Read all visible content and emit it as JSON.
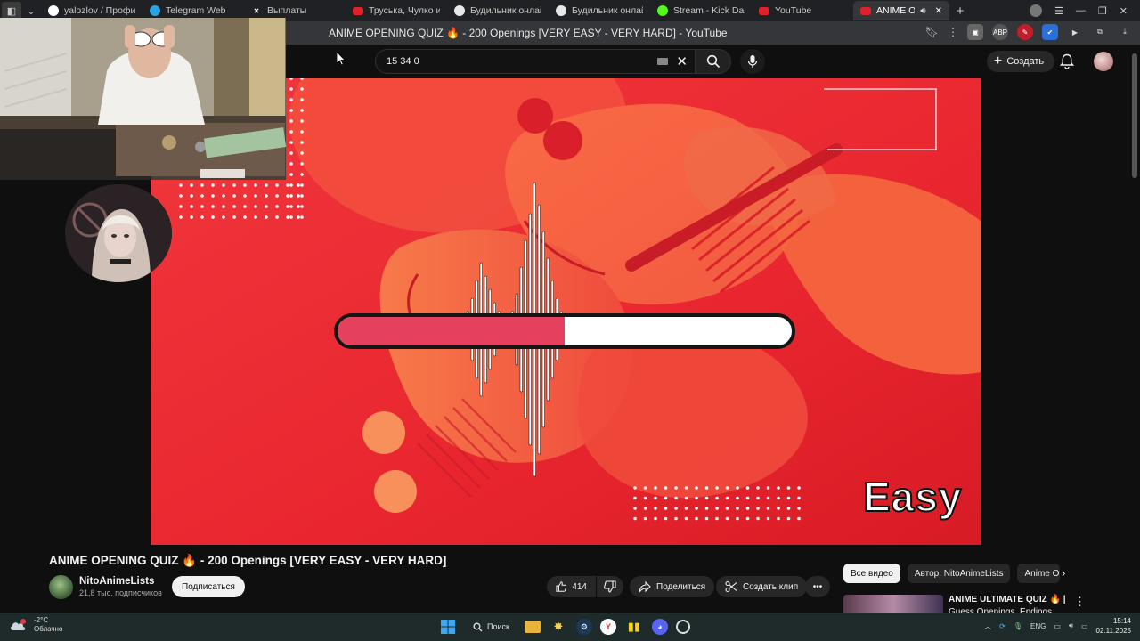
{
  "browser": {
    "tabs": [
      {
        "label": "yalozlov / Профиль",
        "icon": "profile-icon",
        "color": "#ffffff"
      },
      {
        "label": "Telegram Web",
        "icon": "telegram-icon",
        "color": "#2aa3e3"
      },
      {
        "label": "Выплаты",
        "icon": "x-icon",
        "color": "#ffffff"
      },
      {
        "label": "Труська, Чулко и пр",
        "icon": "youtube-icon",
        "color": "#e1202b"
      },
      {
        "label": "Будильник онлайн",
        "icon": "check-icon",
        "color": "#e8e8e8"
      },
      {
        "label": "Будильник онлайн",
        "icon": "check-icon",
        "color": "#e8e8e8"
      },
      {
        "label": "Stream - Kick Dashbo",
        "icon": "kick-icon",
        "color": "#53fc18"
      },
      {
        "label": "YouTube",
        "icon": "youtube-icon",
        "color": "#e1202b"
      },
      {
        "label": "ANIME OPENIN",
        "icon": "youtube-icon",
        "color": "#e1202b",
        "active": true
      }
    ],
    "window_title": "ANIME OPENING QUIZ 🔥 - 200 Openings [VERY EASY - VERY HARD] - YouTube"
  },
  "youtube": {
    "search_value": "15 34 0",
    "create_label": "Создать"
  },
  "video": {
    "difficulty_label": "Easy",
    "progress_fraction": 0.5,
    "colors": {
      "background": "#ea2c35",
      "bar_fill": "#e5415e"
    }
  },
  "info": {
    "title": "ANIME OPENING QUIZ 🔥 - 200 Openings [VERY EASY - VERY HARD]",
    "channel_name": "NitoAnimeLists",
    "channel_subs": "21,8 тыс. подписчиков",
    "subscribe_label": "Подписаться",
    "likes": "414",
    "share_label": "Поделиться",
    "clip_label": "Создать клип",
    "more_label": "•••"
  },
  "sidebar": {
    "chips": [
      "Все видео",
      "Автор: NitoAnimeLists",
      "Anime O"
    ],
    "rec_title": "ANIME ULTIMATE QUIZ 🔥 |",
    "rec_title2": "Guess Openings, Endings"
  },
  "taskbar": {
    "temp": "-2°C",
    "weather": "Облачно",
    "search_label": "Поиск",
    "lang": "ENG",
    "time": "15:14",
    "date": "02.11.2025"
  }
}
